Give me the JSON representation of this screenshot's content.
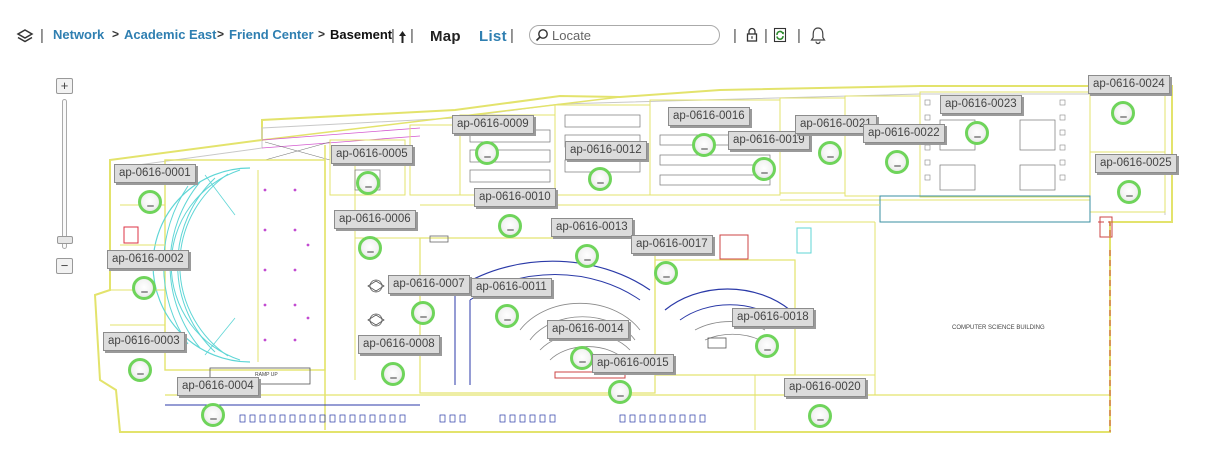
{
  "breadcrumb": {
    "items": [
      "Network",
      "Academic East",
      "Friend Center",
      "Basement"
    ],
    "separator": ">"
  },
  "view_tabs": {
    "map": "Map",
    "list": "List"
  },
  "search": {
    "placeholder": "Locate",
    "value": ""
  },
  "icons": {
    "layers": "layers-icon",
    "floor_up": "floor-up-arrow-icon",
    "search": "search-icon",
    "lock": "lock-icon",
    "refresh": "refresh-icon",
    "bell": "bell-icon"
  },
  "zoom": {
    "in_label": "+",
    "out_label": "−"
  },
  "floorplan": {
    "building_text": "COMPUTER SCIENCE BUILDING",
    "ramp_text": "RAMP UP",
    "access_points": [
      {
        "id": "ap-0616-0001"
      },
      {
        "id": "ap-0616-0002"
      },
      {
        "id": "ap-0616-0003"
      },
      {
        "id": "ap-0616-0004"
      },
      {
        "id": "ap-0616-0005"
      },
      {
        "id": "ap-0616-0006"
      },
      {
        "id": "ap-0616-0007"
      },
      {
        "id": "ap-0616-0008"
      },
      {
        "id": "ap-0616-0009"
      },
      {
        "id": "ap-0616-0010"
      },
      {
        "id": "ap-0616-0011"
      },
      {
        "id": "ap-0616-0012"
      },
      {
        "id": "ap-0616-0013"
      },
      {
        "id": "ap-0616-0014"
      },
      {
        "id": "ap-0616-0015"
      },
      {
        "id": "ap-0616-0016"
      },
      {
        "id": "ap-0616-0017"
      },
      {
        "id": "ap-0616-0018"
      },
      {
        "id": "ap-0616-0019"
      },
      {
        "id": "ap-0616-0020"
      },
      {
        "id": "ap-0616-0021"
      },
      {
        "id": "ap-0616-0022"
      },
      {
        "id": "ap-0616-0023"
      },
      {
        "id": "ap-0616-0024"
      },
      {
        "id": "ap-0616-0025"
      }
    ]
  },
  "colors": {
    "link": "#2f7fb1",
    "ap_ring": "#6fd45b",
    "plan_yellow": "#e8e86a",
    "plan_cyan": "#5fd6d6",
    "plan_blue": "#2b3aa8",
    "plan_magenta": "#c24bd1"
  }
}
